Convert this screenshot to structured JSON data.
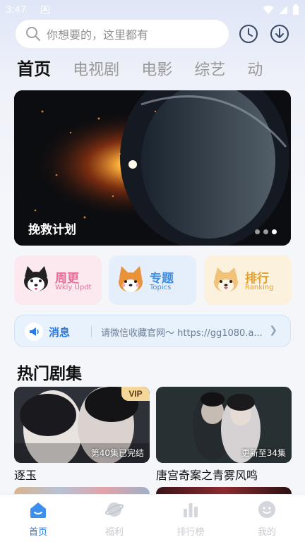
{
  "status": {
    "time": "3:47",
    "notif": "A"
  },
  "search": {
    "placeholder": "你想要的，这里都有"
  },
  "tabs": [
    "首页",
    "电视剧",
    "电影",
    "综艺",
    "动"
  ],
  "banner": {
    "title": "挽救计划",
    "dots": 3,
    "active_dot": 3
  },
  "categories": [
    {
      "title": "周更",
      "sub": "Wkly Updt",
      "color": "#e86c97",
      "bg": "#fce8ef"
    },
    {
      "title": "专题",
      "sub": "Topics",
      "color": "#3e8de0",
      "bg": "#e4effb"
    },
    {
      "title": "排行",
      "sub": "Ranking",
      "color": "#e3a12a",
      "bg": "#fcf1dc"
    }
  ],
  "notice": {
    "label": "消息",
    "text": "请微信收藏官网～ https://gg1080.a..."
  },
  "section": {
    "title": "热门剧集"
  },
  "cards": [
    {
      "title": "逐玉",
      "badge": "第40集已完结",
      "vip": "VIP"
    },
    {
      "title": "唐宫奇案之青雾风鸣",
      "badge": "更新至34集"
    }
  ],
  "nav": [
    {
      "label": "首页",
      "active": true
    },
    {
      "label": "福利"
    },
    {
      "label": "排行榜"
    },
    {
      "label": "我的"
    }
  ]
}
